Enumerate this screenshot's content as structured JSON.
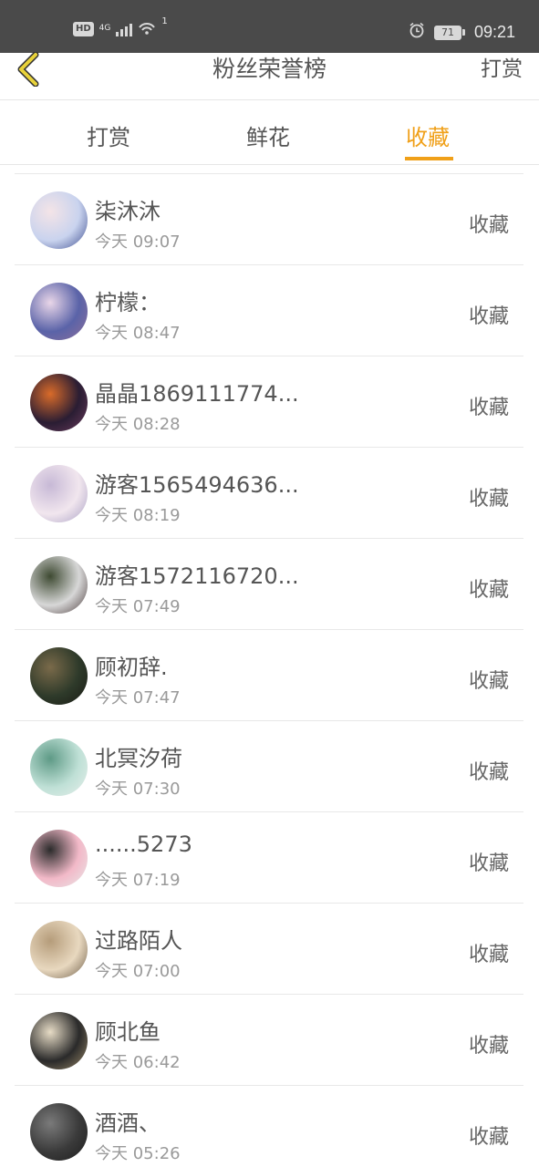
{
  "status_bar": {
    "hd": "HD",
    "network": "4G",
    "wifi_badge": "1",
    "battery": "71",
    "time": "09:21",
    "icons": [
      "hd-icon",
      "signal-icon",
      "wifi-icon",
      "alarm-icon",
      "battery-icon"
    ]
  },
  "header": {
    "title": "粉丝荣誉榜",
    "action": "打赏",
    "back_icon": "chevron-left-icon",
    "back_color": "#e8d23a"
  },
  "tabs": [
    {
      "label": "打赏",
      "active": false
    },
    {
      "label": "鲜花",
      "active": false
    },
    {
      "label": "收藏",
      "active": true
    }
  ],
  "accent_color": "#f0a019",
  "list": [
    {
      "name": "柒沐沐",
      "time": "今天 09:07",
      "action": "收藏",
      "avatar_colors": [
        "#c9d3ee",
        "#f4e4e7",
        "#3b4c8f"
      ]
    },
    {
      "name": "柠檬：",
      "time": "今天 08:47",
      "action": "收藏",
      "avatar_colors": [
        "#5a63a8",
        "#e9d6e8",
        "#8e6f9b"
      ]
    },
    {
      "name": "晶晶1869111774...",
      "time": "今天 08:28",
      "action": "收藏",
      "avatar_colors": [
        "#2a1d33",
        "#d96b2a",
        "#6b3b5c"
      ]
    },
    {
      "name": "游客1565494636...",
      "time": "今天 08:19",
      "action": "收藏",
      "avatar_colors": [
        "#f1e6ee",
        "#c7b9d6",
        "#a9a0c4"
      ]
    },
    {
      "name": "游客1572116720...",
      "time": "今天 07:49",
      "action": "收藏",
      "avatar_colors": [
        "#d7d7d7",
        "#3e4a32",
        "#4a3b3b"
      ]
    },
    {
      "name": "顾初辞.",
      "time": "今天 07:47",
      "action": "收藏",
      "avatar_colors": [
        "#2e3a2a",
        "#7a6a4a",
        "#1a1a14"
      ]
    },
    {
      "name": "北冥汐荷",
      "time": "今天 07:30",
      "action": "收藏",
      "avatar_colors": [
        "#bfe0d6",
        "#5e9a86",
        "#e8f0ec"
      ]
    },
    {
      "name": "......5273",
      "time": "今天 07:19",
      "action": "收藏",
      "avatar_colors": [
        "#f2b9c8",
        "#2b2b2b",
        "#e9e9e9"
      ]
    },
    {
      "name": "过路陌人",
      "time": "今天 07:00",
      "action": "收藏",
      "avatar_colors": [
        "#e8d8bf",
        "#b59c7a",
        "#6b5a45"
      ]
    },
    {
      "name": "顾北鱼",
      "time": "今天 06:42",
      "action": "收藏",
      "avatar_colors": [
        "#2a2a2a",
        "#e7dcc6",
        "#9b8a6a"
      ]
    },
    {
      "name": "酒酒、",
      "time": "今天 05:26",
      "action": "收藏",
      "avatar_colors": [
        "#3a3a3a",
        "#7a7a7a",
        "#1e1e1e"
      ]
    }
  ]
}
